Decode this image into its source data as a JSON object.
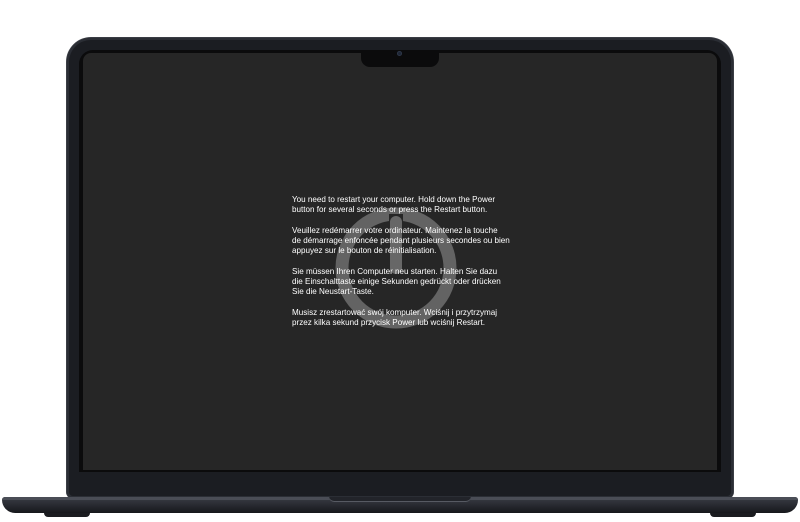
{
  "kernel_panic": {
    "messages": [
      {
        "lang": "en",
        "line1": "You need to restart your computer. Hold down the Power",
        "line2": "button for several seconds or press the Restart button."
      },
      {
        "lang": "fr",
        "line1": "Veuillez redémarrer votre ordinateur. Maintenez la touche",
        "line2": "de démarrage enfoncée pendant plusieurs secondes ou bien",
        "line3": "appuyez sur le bouton de réinitialisation."
      },
      {
        "lang": "de",
        "line1": "Sie müssen Ihren Computer neu starten. Halten Sie dazu",
        "line2": "die Einschalttaste einige Sekunden gedrückt oder drücken",
        "line3": "Sie die Neustart-Taste."
      },
      {
        "lang": "pl",
        "line1": "Musisz zrestartować swój komputer. Wciśnij i przytrzymaj",
        "line2": "przez kilka sekund przycisk Power lub wciśnij Restart."
      }
    ],
    "icon": "power-icon"
  },
  "colors": {
    "screen_background": "#262626",
    "text": "#ffffff",
    "power_icon": "#6f6f6f",
    "bezel": "#0b0b0c",
    "chassis": "#1b1d22"
  }
}
